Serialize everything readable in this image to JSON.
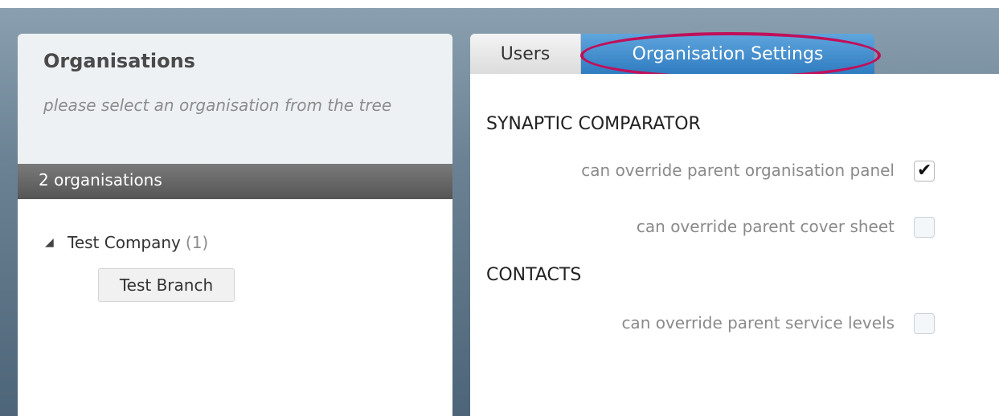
{
  "organisations_panel": {
    "title": "Organisations",
    "subtitle": "please select an organisation from the tree",
    "count_label": "2 organisations",
    "tree": {
      "root": {
        "label": "Test Company",
        "count": "(1)",
        "expanded": true,
        "children": [
          {
            "label": "Test Branch"
          }
        ]
      }
    }
  },
  "tabs": [
    {
      "label": "Users",
      "active": false
    },
    {
      "label": "Organisation Settings",
      "active": true
    }
  ],
  "settings": {
    "sections": [
      {
        "title": "SYNAPTIC COMPARATOR",
        "items": [
          {
            "label": "can override parent organisation panel",
            "checked": true
          },
          {
            "label": "can override parent cover sheet",
            "checked": false
          }
        ]
      },
      {
        "title": "CONTACTS",
        "items": [
          {
            "label": "can override parent service levels",
            "checked": false
          }
        ]
      }
    ]
  },
  "colors": {
    "active_tab": "#2f7cc0",
    "highlight_ellipse": "#c0105a",
    "background": "#6b8294"
  },
  "icons": {
    "tree_toggle": "triangle-down-icon",
    "checkmark": "checkmark-icon"
  }
}
